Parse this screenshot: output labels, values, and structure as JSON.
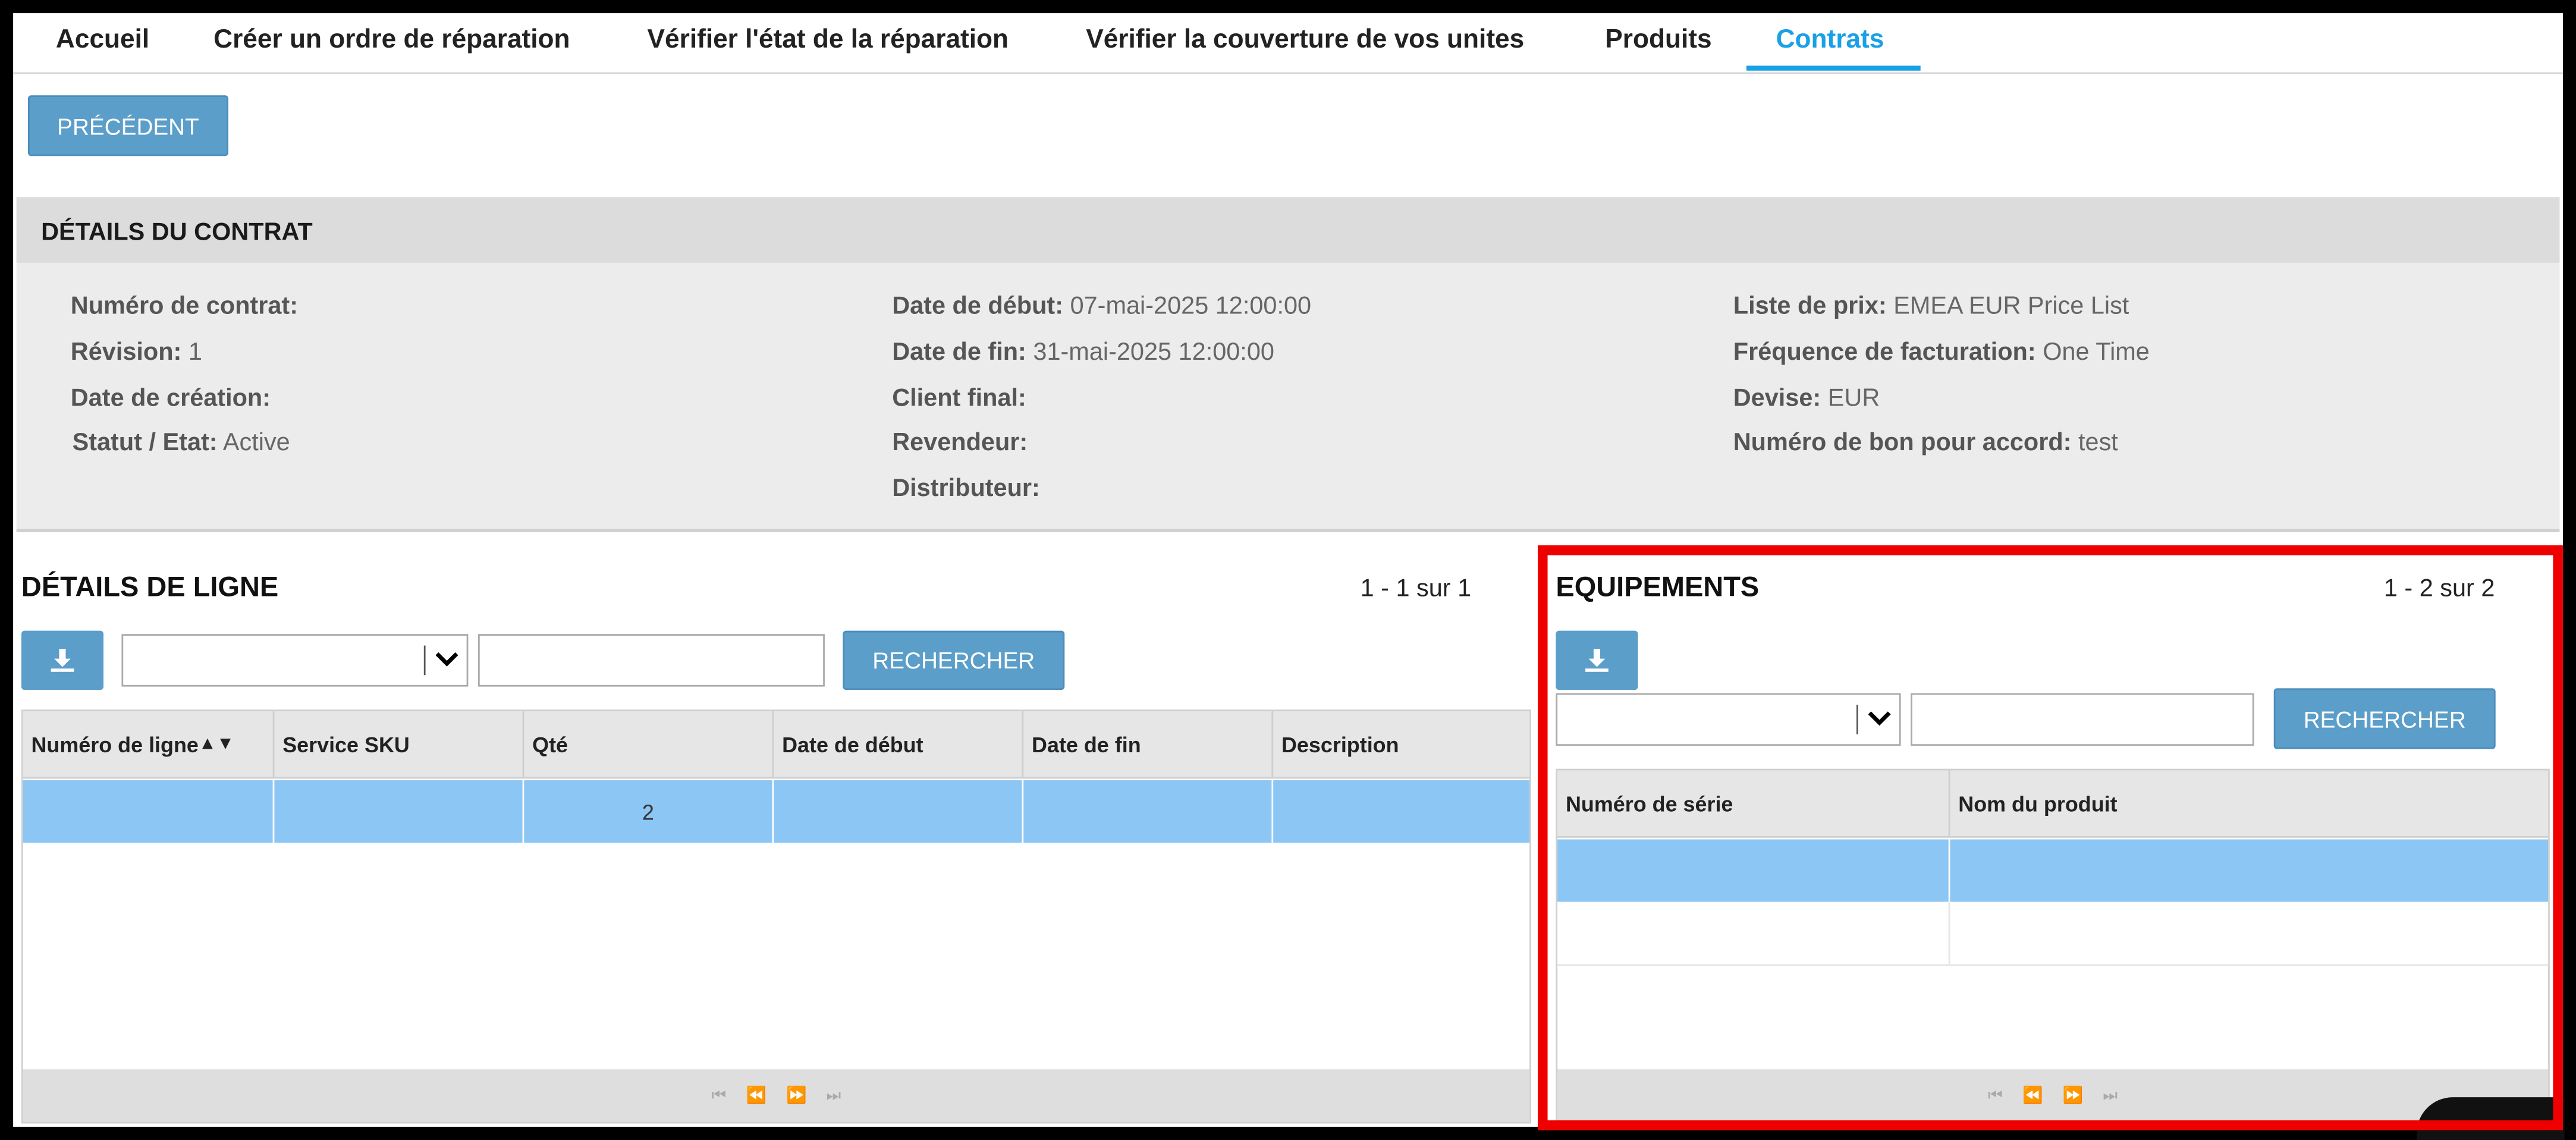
{
  "tabs": [
    "Accueil",
    "Créer un ordre de réparation",
    "Vérifier l'état de la réparation",
    "Vérifier la couverture de vos unites",
    "Produits",
    "Contrats"
  ],
  "active_tab": "Contrats",
  "back_button": "PRÉCÉDENT",
  "contract": {
    "title": "DÉTAILS DU CONTRAT",
    "col1": [
      {
        "label": "Numéro de contrat:",
        "value": ""
      },
      {
        "label": "Révision:",
        "value": "1"
      },
      {
        "label": "Date de création:",
        "value": ""
      },
      {
        "label": "Statut / Etat:",
        "value": "Active"
      }
    ],
    "col2": [
      {
        "label": "Date de début:",
        "value": "07-mai-2025 12:00:00"
      },
      {
        "label": "Date de fin:",
        "value": "31-mai-2025 12:00:00"
      },
      {
        "label": "Client final:",
        "value": ""
      },
      {
        "label": "Revendeur:",
        "value": ""
      },
      {
        "label": "Distributeur:",
        "value": ""
      }
    ],
    "col3": [
      {
        "label": "Liste de prix:",
        "value": "EMEA EUR Price List"
      },
      {
        "label": "Fréquence de facturation:",
        "value": "One Time"
      },
      {
        "label": "Devise:",
        "value": "EUR"
      },
      {
        "label": "Numéro de bon pour accord:",
        "value": "test"
      }
    ]
  },
  "lines": {
    "title": "DÉTAILS DE LIGNE",
    "count": "1 - 1 sur 1",
    "search_label": "RECHERCHER",
    "sort_indicator": "▲▼",
    "columns": [
      "Numéro de ligne",
      "Service SKU",
      "Qté",
      "Date de début",
      "Date de fin",
      "Description"
    ],
    "rows": [
      [
        "",
        "",
        "2",
        "",
        "",
        ""
      ]
    ]
  },
  "equipment": {
    "title": "EQUIPEMENTS",
    "count": "1 - 2 sur 2",
    "search_label": "RECHERCHER",
    "columns": [
      "Numéro de série",
      "Nom du produit"
    ],
    "rows": [
      [
        "",
        ""
      ],
      [
        "",
        ""
      ]
    ]
  },
  "pager_icons": [
    "first-page-icon",
    "prev-page-icon",
    "next-page-icon",
    "last-page-icon"
  ],
  "colors": {
    "accent": "#1aa0e6",
    "button": "#5b9ec9",
    "selected_row": "#8cc6f4",
    "highlight": "#ee0000"
  }
}
